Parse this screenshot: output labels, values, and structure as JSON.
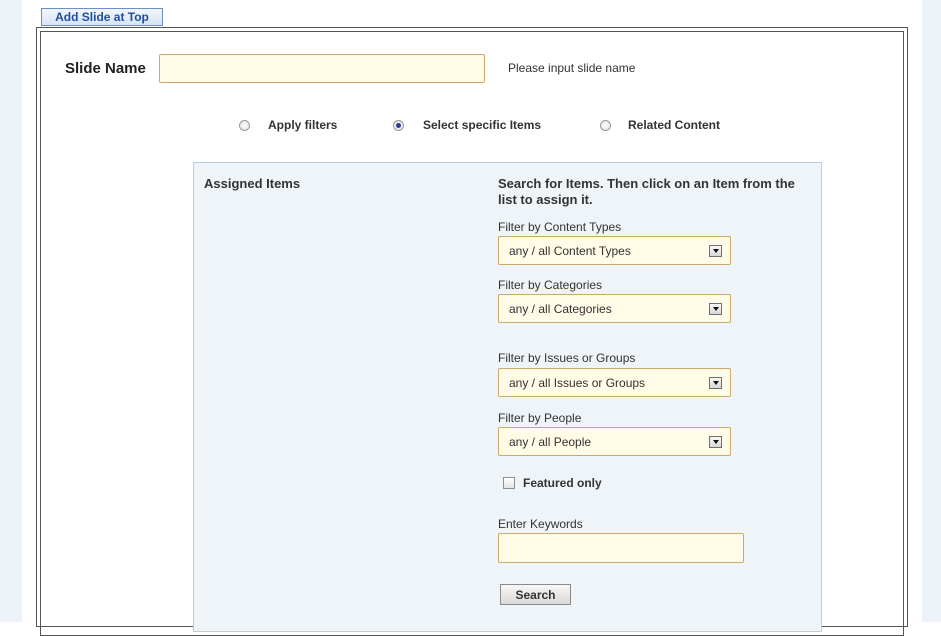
{
  "toolbar": {
    "add_slide_top_label": "Add Slide at Top"
  },
  "slide": {
    "name_label": "Slide Name",
    "name_value": "",
    "name_hint": "Please input slide name"
  },
  "mode_options": [
    {
      "label": "Apply filters",
      "selected": false
    },
    {
      "label": "Select specific Items",
      "selected": true
    },
    {
      "label": "Related Content",
      "selected": false
    }
  ],
  "assigned": {
    "title": "Assigned Items"
  },
  "search": {
    "instructions": "Search for Items. Then click on an Item from the list to assign it.",
    "filters": [
      {
        "label": "Filter by Content Types",
        "selected": "any / all Content Types"
      },
      {
        "label": "Filter by Categories",
        "selected": "any / all Categories"
      },
      {
        "label": "Filter by Issues or Groups",
        "selected": "any / all Issues or Groups"
      },
      {
        "label": "Filter by People",
        "selected": "any / all People"
      }
    ],
    "featured_label": "Featured only",
    "featured_checked": false,
    "keywords_label": "Enter Keywords",
    "keywords_value": "",
    "search_button": "Search"
  },
  "colors": {
    "accent": "#1f4f9c",
    "input_bg": "#fffbe6",
    "panel_bg": "#eef4f8",
    "side_bg": "#eef3f9"
  }
}
